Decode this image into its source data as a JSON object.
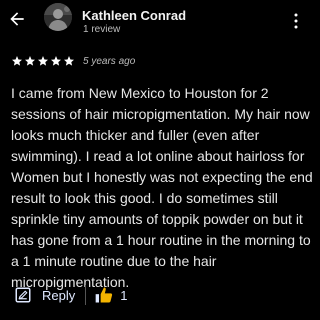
{
  "header": {
    "reviewer_name": "Kathleen Conrad",
    "review_count": "1 review"
  },
  "review": {
    "rating": 5,
    "max_rating": 5,
    "date": "5 years ago",
    "text": "I came from New Mexico to Houston for 2 sessions of hair micropigmentation. My hair now looks much thicker and fuller (even after swimming). I read a lot online about hairloss for Women but I honestly was not expecting the end result to look this good. I do sometimes still sprinkle tiny amounts of toppik powder on but it has gone from a 1 hour routine in the morning to a 1 minute routine due to the hair micropigmentation."
  },
  "actions": {
    "reply_label": "Reply",
    "like_count": "1"
  },
  "icons": {
    "back": "arrow-back-icon",
    "menu": "more-vert-icon",
    "reply": "reply-icon",
    "like": "thumbs-up-icon",
    "star": "star-icon"
  },
  "colors": {
    "background": "#000000",
    "star": "#ffffff",
    "accent": "#dfe8ff"
  }
}
